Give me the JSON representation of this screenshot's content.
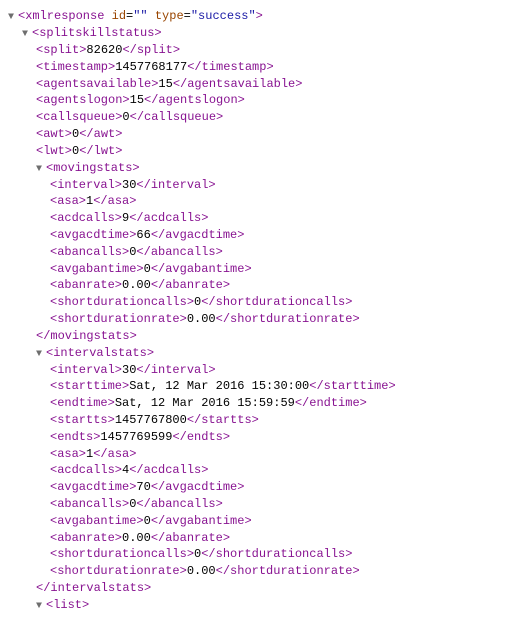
{
  "twisty": "▼",
  "root": {
    "open": "<xmlresponse",
    "idAttr": "id",
    "idVal": "\"\"",
    "typeAttr": "type",
    "typeVal": "\"success\"",
    "gt": ">"
  },
  "sss": {
    "open": "<splitskillstatus",
    "gt": ">"
  },
  "split": {
    "open": "<split>",
    "val": "82620",
    "close": "</split>"
  },
  "timestamp": {
    "open": "<timestamp>",
    "val": "1457768177",
    "close": "</timestamp>"
  },
  "agentsavailable": {
    "open": "<agentsavailable>",
    "val": "15",
    "close": "</agentsavailable>"
  },
  "agentslogon": {
    "open": "<agentslogon>",
    "val": "15",
    "close": "</agentslogon>"
  },
  "callsqueue": {
    "open": "<callsqueue>",
    "val": "0",
    "close": "</callsqueue>"
  },
  "awt": {
    "open": "<awt>",
    "val": "0",
    "close": "</awt>"
  },
  "lwt": {
    "open": "<lwt>",
    "val": "0",
    "close": "</lwt>"
  },
  "moving": {
    "open": "<movingstats",
    "gt": ">",
    "interval": {
      "open": "<interval>",
      "val": "30",
      "close": "</interval>"
    },
    "asa": {
      "open": "<asa>",
      "val": "1",
      "close": "</asa>"
    },
    "acdcalls": {
      "open": "<acdcalls>",
      "val": "9",
      "close": "</acdcalls>"
    },
    "avgacdtime": {
      "open": "<avgacdtime>",
      "val": "66",
      "close": "</avgacdtime>"
    },
    "abancalls": {
      "open": "<abancalls>",
      "val": "0",
      "close": "</abancalls>"
    },
    "avgabantime": {
      "open": "<avgabantime>",
      "val": "0",
      "close": "</avgabantime>"
    },
    "abanrate": {
      "open": "<abanrate>",
      "val": "0.00",
      "close": "</abanrate>"
    },
    "shortdur": {
      "open": "<shortdurationcalls>",
      "val": "0",
      "close": "</shortdurationcalls>"
    },
    "shortdurrate": {
      "open": "<shortdurationrate>",
      "val": "0.00",
      "close": "</shortdurationrate>"
    },
    "close": "</movingstats>"
  },
  "interval": {
    "open": "<intervalstats",
    "gt": ">",
    "interval": {
      "open": "<interval>",
      "val": "30",
      "close": "</interval>"
    },
    "starttime": {
      "open": "<starttime>",
      "val": "Sat, 12 Mar 2016 15:30:00",
      "close": "</starttime>"
    },
    "endtime": {
      "open": "<endtime>",
      "val": "Sat, 12 Mar 2016 15:59:59",
      "close": "</endtime>"
    },
    "startts": {
      "open": "<startts>",
      "val": "1457767800",
      "close": "</startts>"
    },
    "endts": {
      "open": "<endts>",
      "val": "1457769599",
      "close": "</endts>"
    },
    "asa": {
      "open": "<asa>",
      "val": "1",
      "close": "</asa>"
    },
    "acdcalls": {
      "open": "<acdcalls>",
      "val": "4",
      "close": "</acdcalls>"
    },
    "avgacdtime": {
      "open": "<avgacdtime>",
      "val": "70",
      "close": "</avgacdtime>"
    },
    "abancalls": {
      "open": "<abancalls>",
      "val": "0",
      "close": "</abancalls>"
    },
    "avgabantime": {
      "open": "<avgabantime>",
      "val": "0",
      "close": "</avgabantime>"
    },
    "abanrate": {
      "open": "<abanrate>",
      "val": "0.00",
      "close": "</abanrate>"
    },
    "shortdur": {
      "open": "<shortdurationcalls>",
      "val": "0",
      "close": "</shortdurationcalls>"
    },
    "shortdurrate": {
      "open": "<shortdurationrate>",
      "val": "0.00",
      "close": "</shortdurationrate>"
    },
    "close": "</intervalstats>"
  },
  "list": {
    "open": "<list",
    "gt": ">"
  }
}
